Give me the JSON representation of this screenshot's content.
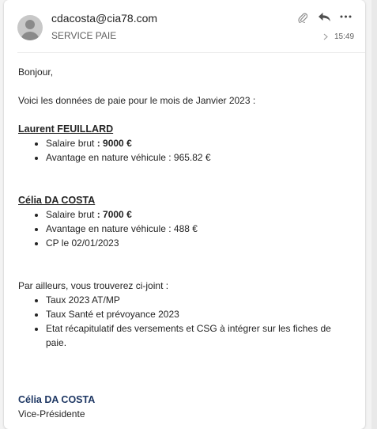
{
  "header": {
    "sender_email": "cdacosta@cia78.com",
    "recipient": "SERVICE PAIE",
    "time": "15:49"
  },
  "body": {
    "greeting": "Bonjour,",
    "intro": "Voici les données de paie pour le mois de Janvier 2023 :",
    "employees": [
      {
        "name": "Laurent FEUILLARD",
        "items": [
          {
            "label": "Salaire brut ",
            "value": ": 9000 €"
          },
          {
            "label": "Avantage en nature véhicule : 965.82 €",
            "value": ""
          }
        ]
      },
      {
        "name": "Célia DA COSTA",
        "items": [
          {
            "label": "Salaire brut ",
            "value": ": 7000 €"
          },
          {
            "label": "Avantage en nature véhicule : 488 €",
            "value": ""
          },
          {
            "label": "CP le 02/01/2023",
            "value": ""
          }
        ]
      }
    ],
    "attachments_intro": "Par ailleurs, vous trouverez ci-joint :",
    "attachments": [
      "Taux 2023 AT/MP",
      "Taux Santé et prévoyance 2023",
      "Etat récapitulatif des versements et CSG à intégrer sur les fiches de paie."
    ],
    "signature_name": "Célia DA COSTA",
    "signature_title": "Vice-Présidente"
  },
  "icons": {
    "attach": "paperclip-icon",
    "reply": "reply-icon",
    "more": "more-icon",
    "expand": "chevron-right-icon",
    "avatar": "person-avatar"
  }
}
